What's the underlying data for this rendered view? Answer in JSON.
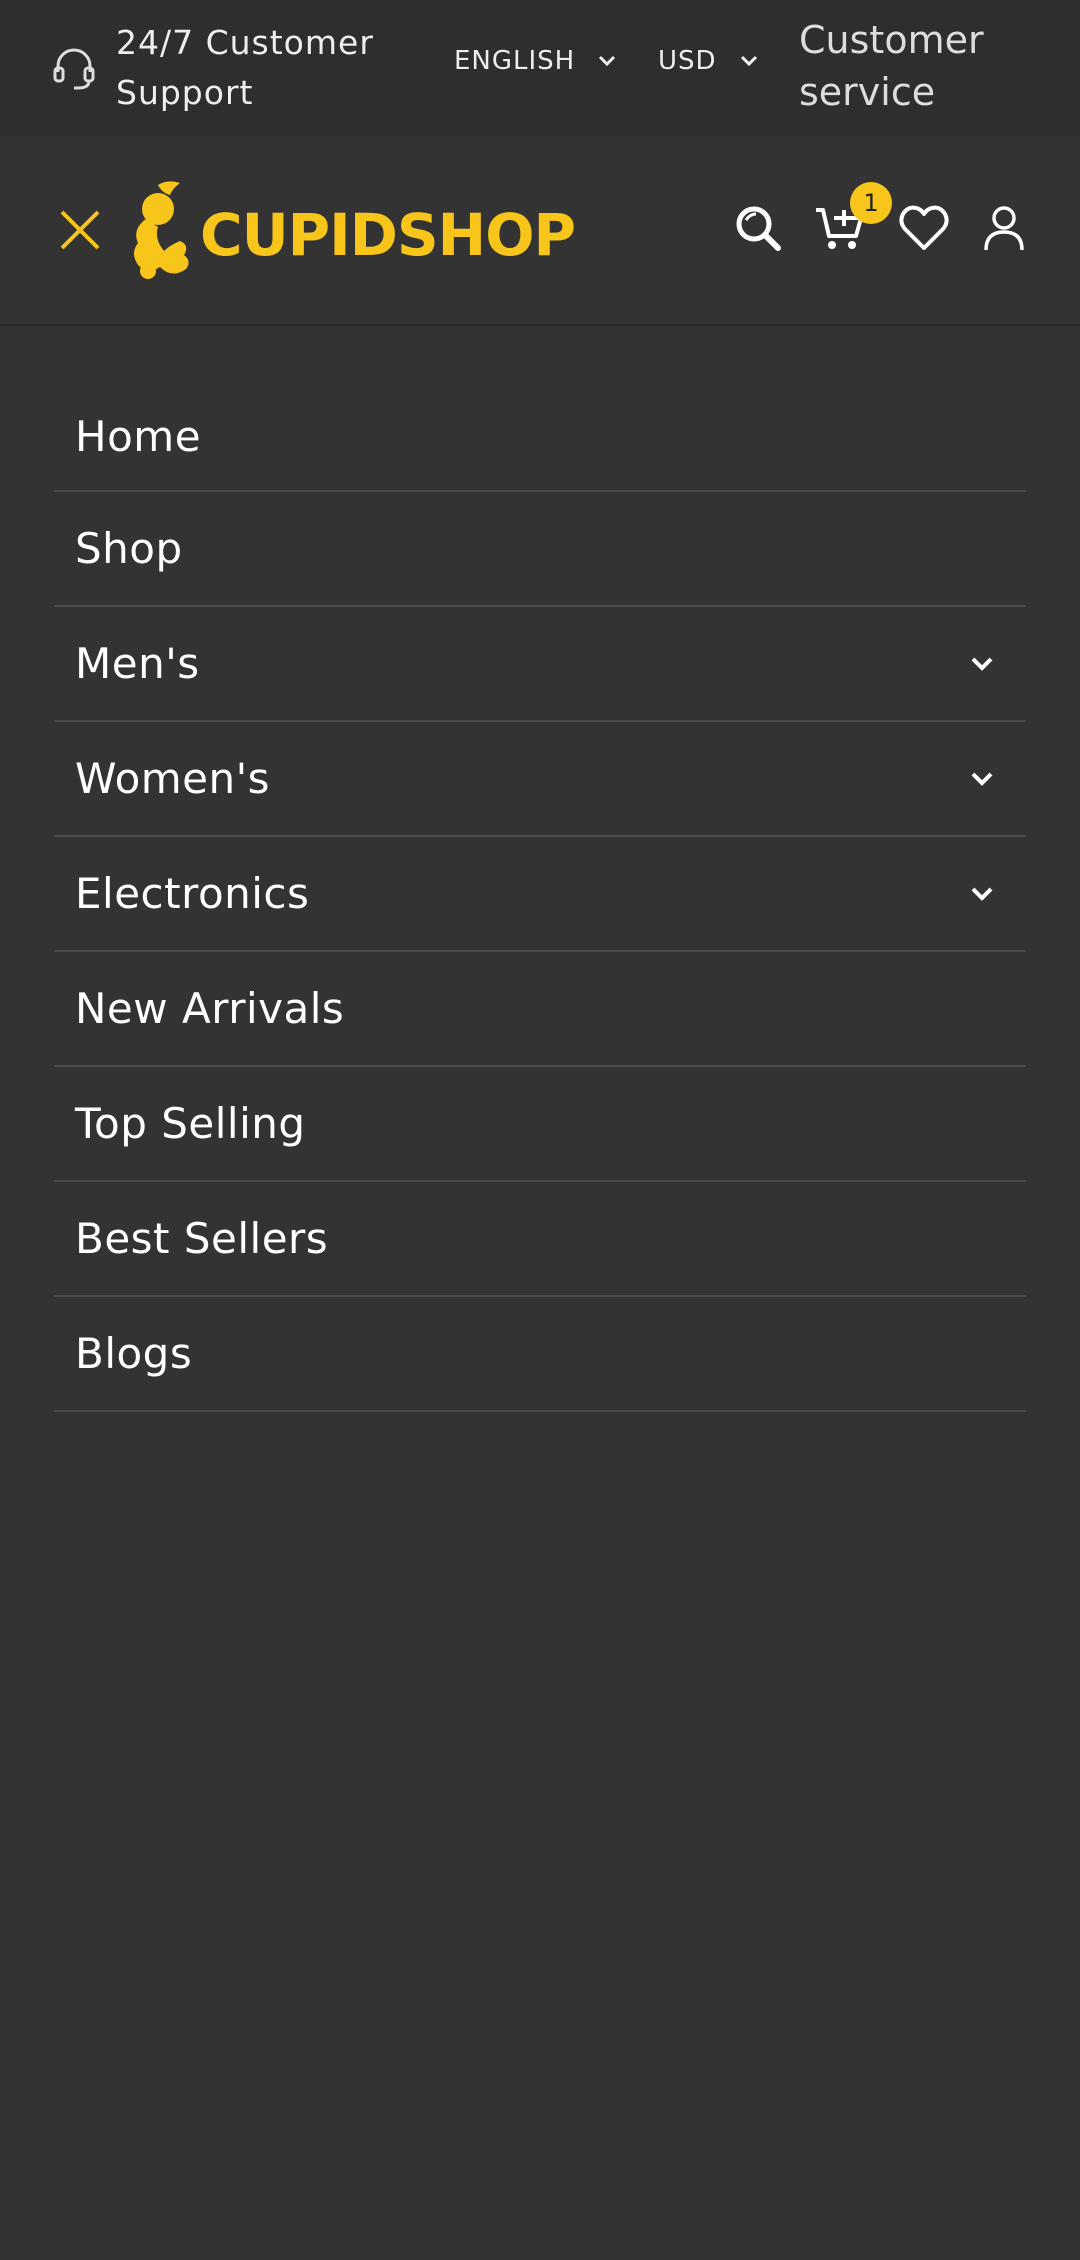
{
  "topbar": {
    "support_label": "24/7 Customer Support",
    "language": "ENGLISH",
    "currency": "USD",
    "customer_service": "Customer service"
  },
  "header": {
    "logo_text": "CUPIDSHOP",
    "cart_count": "1"
  },
  "colors": {
    "accent": "#f8c51a",
    "background": "#333333",
    "topbar_bg": "#2e2e2e",
    "divider": "#4a4a4a"
  },
  "menu": {
    "items": [
      {
        "label": "Home",
        "has_submenu": false
      },
      {
        "label": "Shop",
        "has_submenu": false
      },
      {
        "label": "Men's",
        "has_submenu": true
      },
      {
        "label": "Women's",
        "has_submenu": true
      },
      {
        "label": "Electronics",
        "has_submenu": true
      },
      {
        "label": "New Arrivals",
        "has_submenu": false
      },
      {
        "label": "Top Selling",
        "has_submenu": false
      },
      {
        "label": "Best Sellers",
        "has_submenu": false
      },
      {
        "label": "Blogs",
        "has_submenu": false
      }
    ]
  }
}
